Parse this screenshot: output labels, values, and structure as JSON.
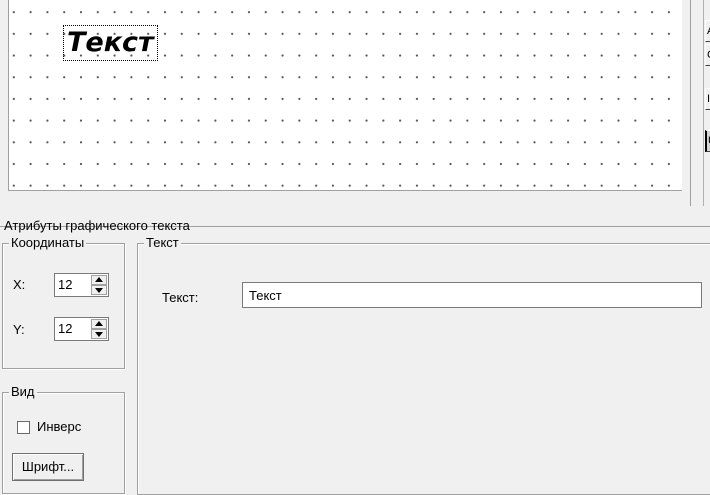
{
  "canvas": {
    "text": "Текст"
  },
  "panel": {
    "title": "Атрибуты графического текста",
    "coordinates": {
      "label": "Координаты",
      "x_label": "X:",
      "x_value": "12",
      "y_label": "Y:",
      "y_value": "12"
    },
    "view": {
      "label": "Вид",
      "inverse_label": "Инверс",
      "inverse_checked": false,
      "font_button": "Шрифт..."
    },
    "text_group": {
      "label": "Текст",
      "field_label": "Текст:",
      "field_value": "Текст"
    }
  },
  "right_toolbar": {
    "items": [
      "A",
      "C",
      "I",
      "U"
    ]
  }
}
